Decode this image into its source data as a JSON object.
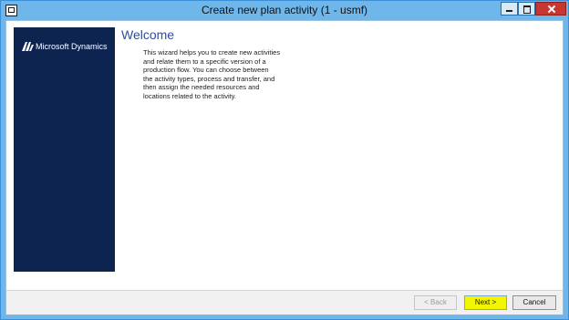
{
  "window": {
    "title": "Create new plan activity (1 - usmf)"
  },
  "brand": {
    "logo_text": "Microsoft Dynamics"
  },
  "page": {
    "heading": "Welcome",
    "intro": "This wizard helps you to create new activities\nand relate them to a specific version of a\nproduction flow. You can choose between\nthe activity types, process and transfer, and\nthen assign the needed resources and\nlocations related to the activity."
  },
  "footer": {
    "back_label": "< Back",
    "next_label": "Next >",
    "cancel_label": "Cancel"
  },
  "colors": {
    "titlebar": "#6fb6ea",
    "brand_panel": "#0e2450",
    "heading": "#2d4ea3",
    "next_highlight": "#f4f600"
  },
  "icons": [
    "app-icon",
    "minimize-icon",
    "maximize-icon",
    "close-icon",
    "microsoft-dynamics-logo"
  ]
}
